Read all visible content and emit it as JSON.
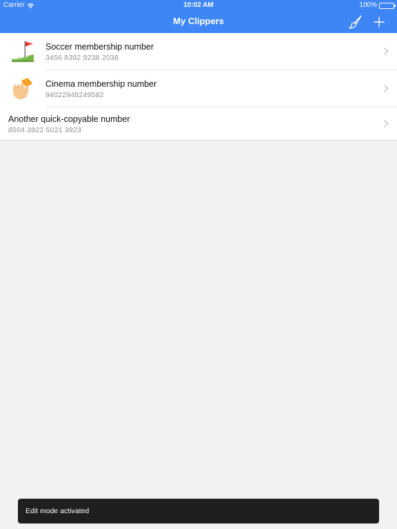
{
  "status_bar": {
    "carrier": "Carrier",
    "time": "10:02 AM",
    "battery": "100%"
  },
  "nav": {
    "title": "My Clippers",
    "left_icon": "brush-icon",
    "right_icon": "plus-icon"
  },
  "clips": [
    {
      "title": "Soccer membership number",
      "value": "3456 8392 9238 2038",
      "icon": "soccer-field-flag-icon"
    },
    {
      "title": "Cinema membership number",
      "value": "94022948249582",
      "icon": "ticket-hand-icon"
    },
    {
      "title": "Another quick-copyable number",
      "value": "8504 3922 5021 3923",
      "icon": null
    }
  ],
  "toast": {
    "message": "Edit mode activated"
  },
  "colors": {
    "accent": "#3e86f5",
    "toast_bg": "#1f1f1f",
    "background": "#f2f2f2"
  }
}
